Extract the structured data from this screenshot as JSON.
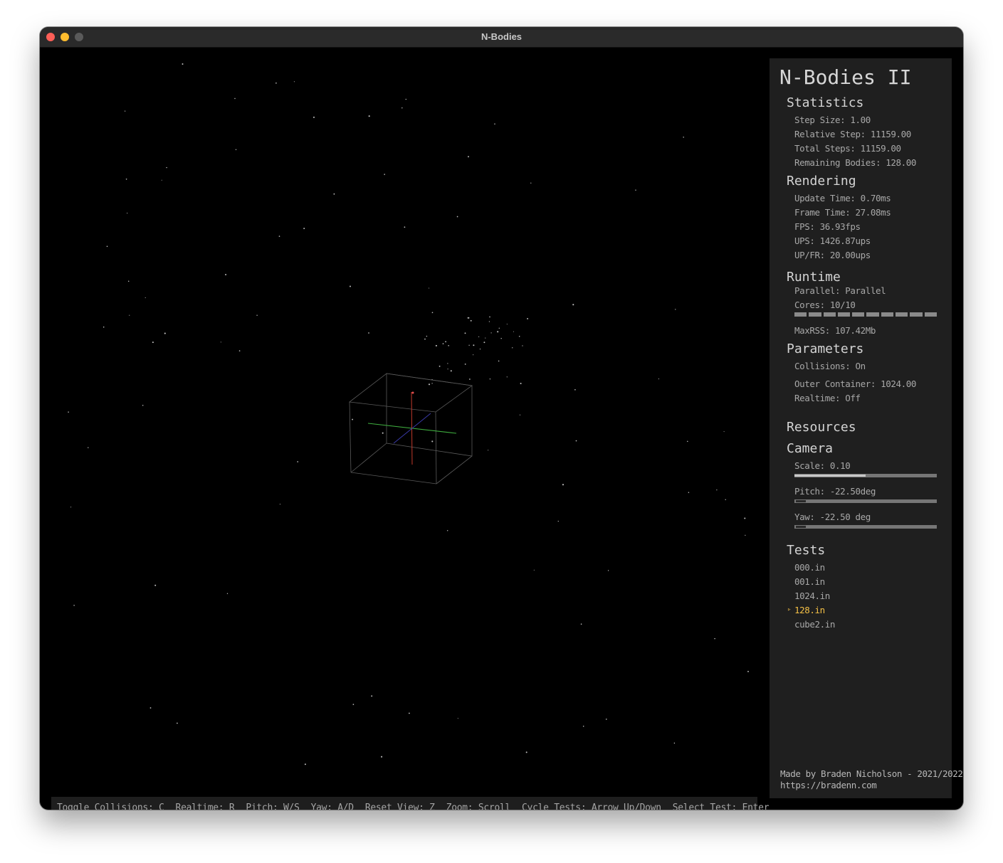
{
  "window": {
    "title": "N-Bodies"
  },
  "hints": [
    "Toggle Collisions: C",
    "Realtime: R",
    "Pitch: W/S",
    "Yaw: A/D",
    "Reset View: Z",
    "Zoom: Scroll",
    "Cycle Tests: Arrow Up/Down",
    "Select Test: Enter"
  ],
  "panel": {
    "app_title": "N-Bodies II",
    "statistics": {
      "title": "Statistics",
      "step_size": "Step Size: 1.00",
      "relative_step": "Relative Step: 11159.00",
      "total_steps": "Total Steps: 11159.00",
      "remaining_bodies": "Remaining Bodies: 128.00"
    },
    "rendering": {
      "title": "Rendering",
      "update_time": "Update Time: 0.70ms",
      "frame_time": "Frame Time: 27.08ms",
      "fps": "FPS: 36.93fps",
      "ups": "UPS: 1426.87ups",
      "up_fr": "UP/FR: 20.00ups"
    },
    "runtime": {
      "title": "Runtime",
      "parallel": "Parallel: Parallel",
      "cores": "Cores: 10/10",
      "cores_active": 10,
      "cores_total": 10,
      "max_rss": "MaxRSS: 107.42Mb"
    },
    "parameters": {
      "title": "Parameters",
      "collisions": "Collisions: On",
      "outer_container": "Outer Container: 1024.00",
      "realtime": "Realtime: Off"
    },
    "resources": {
      "title": "Resources"
    },
    "camera": {
      "title": "Camera",
      "scale": "Scale: 0.10",
      "scale_level": 0.5,
      "pitch": "Pitch: -22.50deg",
      "pitch_level": 0.07,
      "yaw": "Yaw: -22.50 deg",
      "yaw_level": 0.07
    },
    "tests": {
      "title": "Tests",
      "items": [
        "000.in",
        "001.in",
        "1024.in",
        "128.in",
        "cube2.in"
      ],
      "selected": "128.in"
    },
    "footer": {
      "credit": "Made by Braden Nicholson - 2021/2022",
      "url": "https://bradenn.com"
    }
  },
  "colors": {
    "background": "#000000",
    "panel": "#1f1f1f",
    "selected_test": "#f4c046",
    "axis_x": "#3fae3f",
    "axis_y": "#c0392b",
    "axis_z": "#3a3aa8"
  }
}
